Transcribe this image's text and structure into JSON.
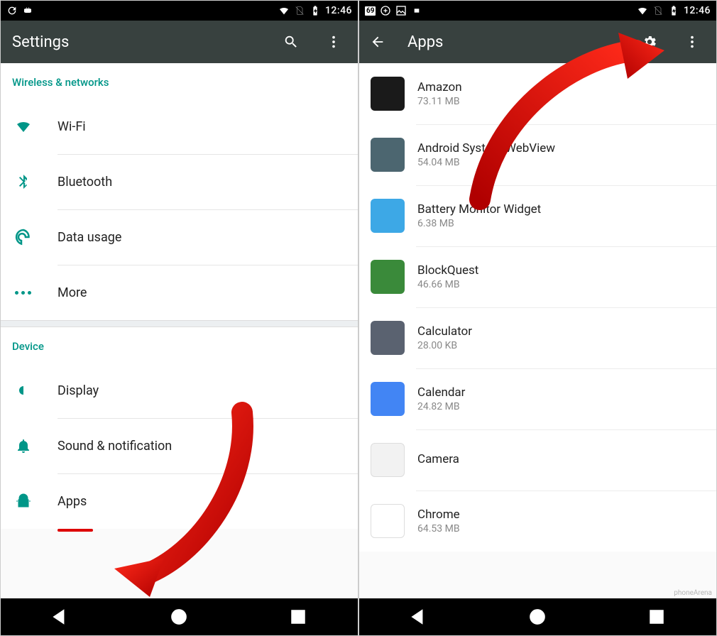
{
  "status": {
    "time": "12:46"
  },
  "left": {
    "title": "Settings",
    "sections": {
      "wireless_header": "Wireless & networks",
      "device_header": "Device"
    },
    "items": {
      "wifi": "Wi-Fi",
      "bluetooth": "Bluetooth",
      "data": "Data usage",
      "more": "More",
      "display": "Display",
      "sound": "Sound & notification",
      "apps": "Apps"
    }
  },
  "right": {
    "title": "Apps",
    "apps": [
      {
        "name": "Amazon",
        "size": "73.11 MB",
        "bg": "#1a1a1a"
      },
      {
        "name": "Android System WebView",
        "size": "54.04 MB",
        "bg": "#4c6670"
      },
      {
        "name": "Battery Monitor Widget",
        "size": "6.38 MB",
        "bg": "#3da8e6"
      },
      {
        "name": "BlockQuest",
        "size": "46.66 MB",
        "bg": "#3a8a3a"
      },
      {
        "name": "Calculator",
        "size": "28.00 KB",
        "bg": "#5a6270"
      },
      {
        "name": "Calendar",
        "size": "24.82 MB",
        "bg": "#4285f4"
      },
      {
        "name": "Camera",
        "size": "",
        "bg": "#f2f2f2"
      },
      {
        "name": "Chrome",
        "size": "64.53 MB",
        "bg": "#ffffff"
      }
    ]
  },
  "watermark": "phoneArena"
}
